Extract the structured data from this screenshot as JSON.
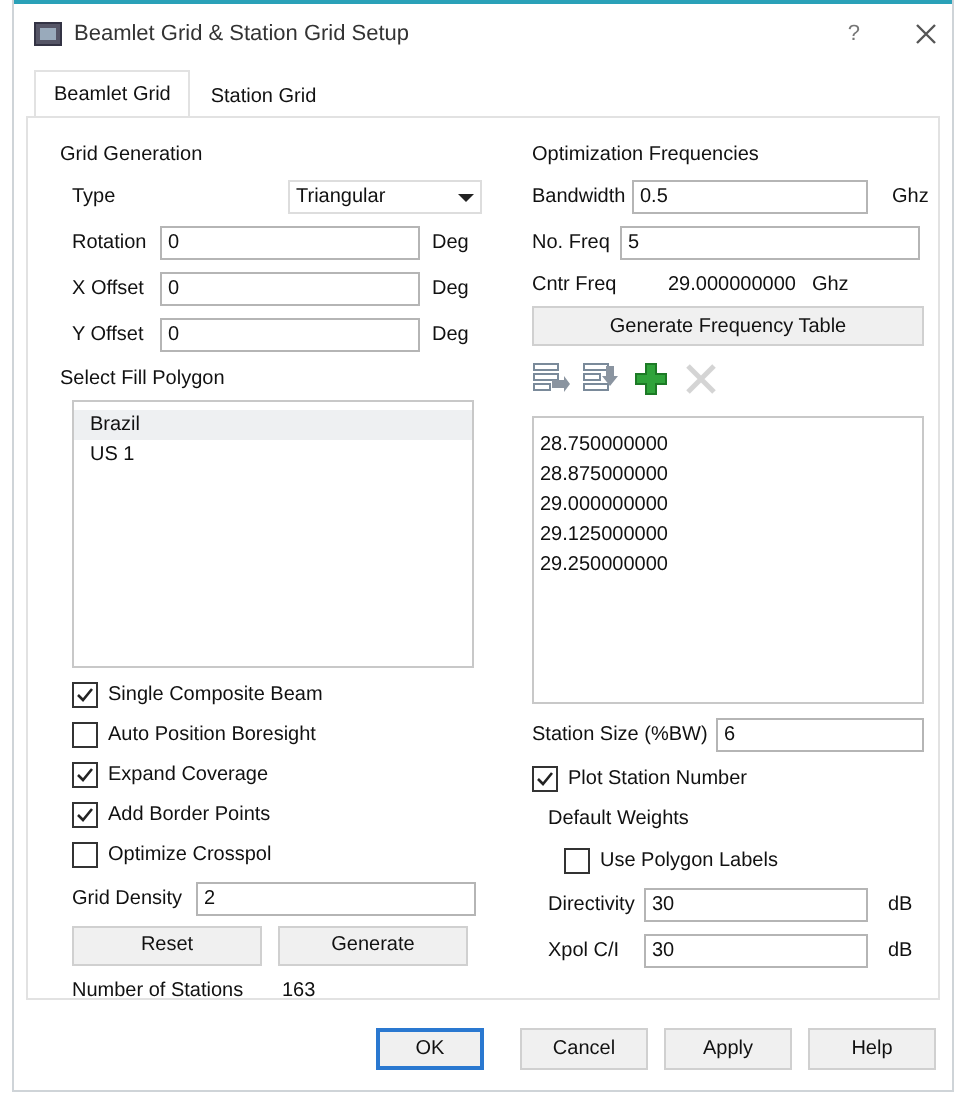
{
  "window": {
    "title": "Beamlet Grid & Station Grid Setup",
    "help": "?"
  },
  "tabs": [
    {
      "label": "Beamlet Grid",
      "selected": true
    },
    {
      "label": "Station Grid",
      "selected": false
    }
  ],
  "grid_generation": {
    "heading": "Grid Generation",
    "type": {
      "label": "Type",
      "value": "Triangular"
    },
    "fields": [
      {
        "label": "Rotation",
        "value": "0",
        "unit": "Deg"
      },
      {
        "label": "X Offset",
        "value": "0",
        "unit": "Deg"
      },
      {
        "label": "Y Offset",
        "value": "0",
        "unit": "Deg"
      }
    ],
    "polygon_label": "Select Fill Polygon",
    "polygons": [
      {
        "text": "Brazil",
        "selected": true
      },
      {
        "text": "US 1",
        "selected": false
      }
    ],
    "options": [
      {
        "label": "Single Composite Beam",
        "checked": true
      },
      {
        "label": "Auto Position Boresight",
        "checked": false
      },
      {
        "label": "Expand Coverage",
        "checked": true
      },
      {
        "label": "Add Border Points",
        "checked": true
      },
      {
        "label": "Optimize Crosspol",
        "checked": false
      }
    ],
    "grid_density": {
      "label": "Grid Density",
      "value": "2"
    },
    "buttons": [
      "Reset",
      "Generate"
    ],
    "stations": {
      "label": "Number of Stations",
      "value": "163"
    }
  },
  "optimization": {
    "heading": "Optimization Frequencies",
    "bandwidth": {
      "label": "Bandwidth",
      "value": "0.5",
      "unit": "Ghz"
    },
    "no_freq": {
      "label": "No. Freq",
      "value": "5"
    },
    "cntr_freq": {
      "label": "Cntr Freq",
      "value": "29.000000000",
      "unit": "Ghz"
    },
    "generate_button": "Generate Frequency Table",
    "toolbar": [
      {
        "kind": "insert-before",
        "disabled": false
      },
      {
        "kind": "insert-after",
        "disabled": false
      },
      {
        "kind": "add",
        "disabled": false
      },
      {
        "kind": "delete",
        "disabled": true
      }
    ],
    "frequencies": [
      "28.750000000",
      "28.875000000",
      "29.000000000",
      "29.125000000",
      "29.250000000"
    ],
    "station_size": {
      "label": "Station Size (%BW)",
      "value": "6"
    },
    "plot_station_number": {
      "label": "Plot Station Number",
      "checked": true
    },
    "default_weights": {
      "heading": "Default Weights",
      "use_polygon_labels": {
        "label": "Use Polygon Labels",
        "checked": false
      },
      "fields": [
        {
          "label": "Directivity",
          "value": "30",
          "unit": "dB"
        },
        {
          "label": "Xpol C/I",
          "value": "30",
          "unit": "dB"
        }
      ]
    }
  },
  "buttons": [
    {
      "label": "OK",
      "default": true
    },
    {
      "label": "Cancel",
      "default": false
    },
    {
      "label": "Apply",
      "default": false
    },
    {
      "label": "Help",
      "default": false
    }
  ]
}
